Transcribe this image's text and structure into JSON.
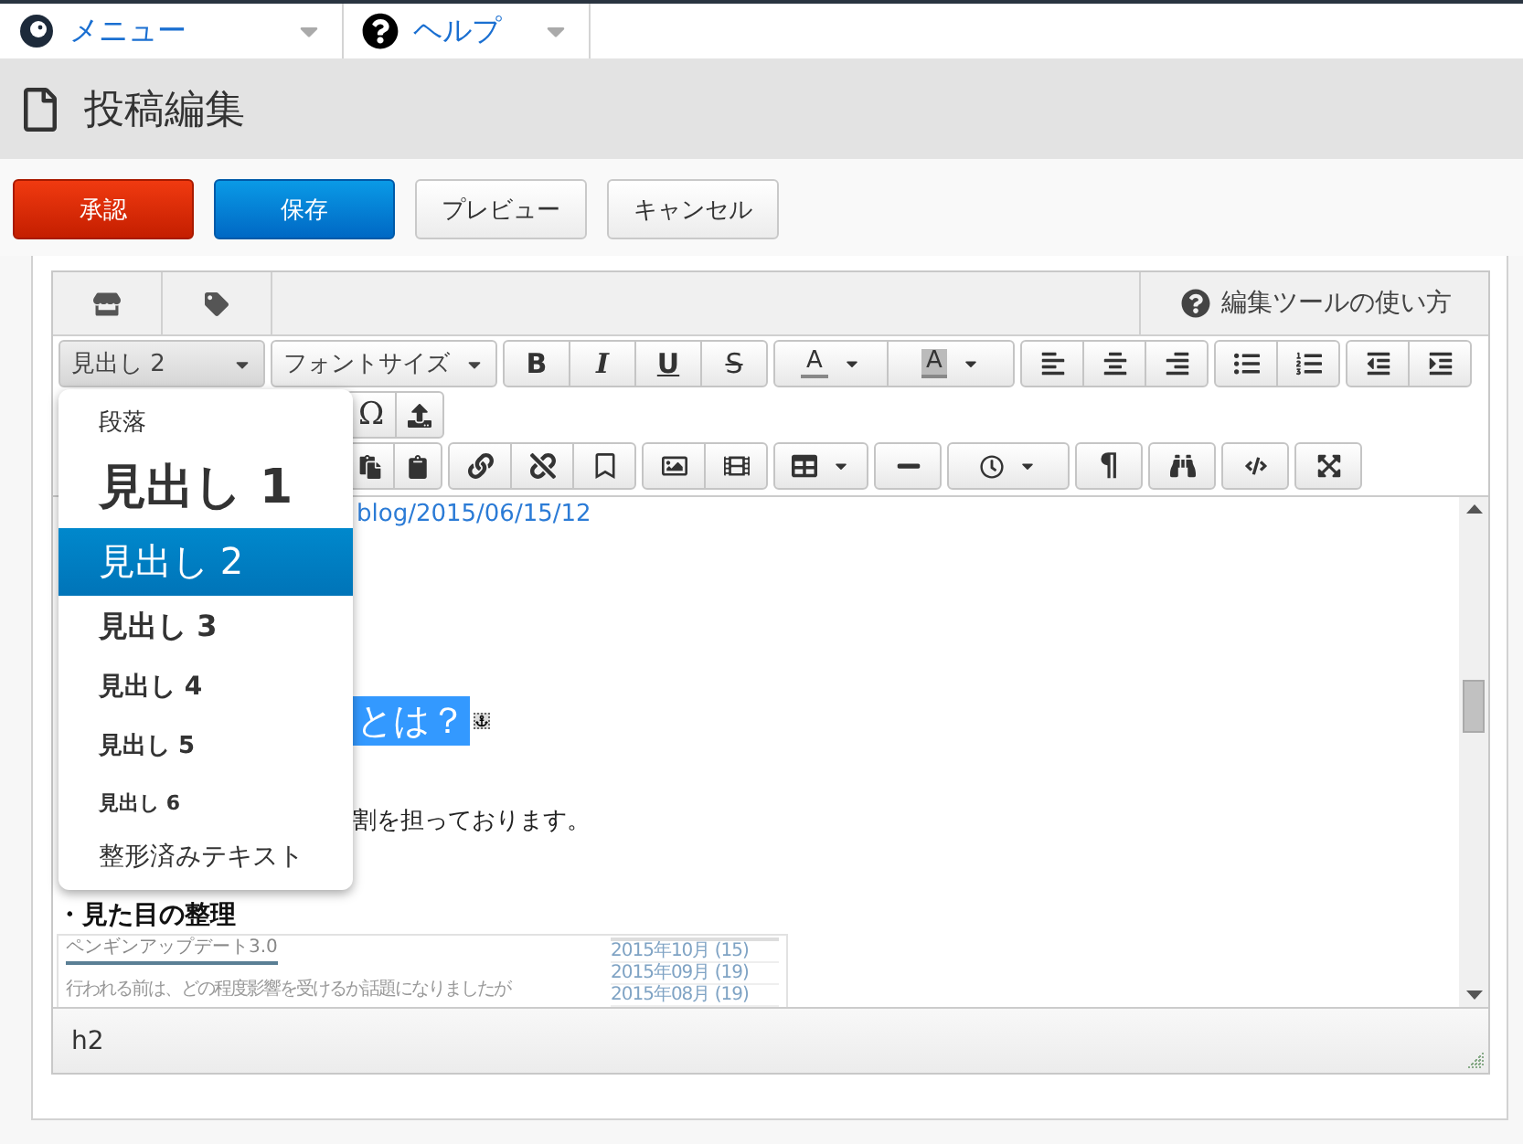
{
  "top_menu": [
    {
      "label": "メニュー",
      "kind": "logo"
    },
    {
      "label": "ヘルプ",
      "kind": "help"
    }
  ],
  "page_title": "投稿編集",
  "actions": [
    {
      "label": "承認",
      "kind": "approve"
    },
    {
      "label": "保存",
      "kind": "primary"
    },
    {
      "label": "プレビュー",
      "kind": "default"
    },
    {
      "label": "キャンセル",
      "kind": "default"
    }
  ],
  "editor": {
    "help_link": "編集ツールの使い方",
    "format_select": "見出し 2",
    "font_size_select": "フォントサイズ",
    "style_buttons": [
      "B",
      "I",
      "U",
      "S"
    ],
    "text_color": "A",
    "background_color": "A",
    "special_char": "Ω",
    "pilcrow": "¶",
    "content": {
      "link": "blog/2015/06/15/12",
      "selected_heading": "とは？",
      "paragraph": "割を担っております。",
      "bold_line": "・見た目の整理",
      "embedded_screenshot": {
        "title": "ペンギンアップデート3.0",
        "text": "行われる前は、どの程度影響を受けるか話題になりましたが",
        "archive": [
          "2015年10月 (15)",
          "2015年09月 (19)",
          "2015年08月 (19)"
        ]
      }
    },
    "status_path": "h2"
  },
  "format_menu": [
    {
      "label": "段落",
      "kind": "p",
      "selected": false
    },
    {
      "label": "見出し 1",
      "kind": "h1",
      "selected": false
    },
    {
      "label": "見出し 2",
      "kind": "h2",
      "selected": true
    },
    {
      "label": "見出し 3",
      "kind": "h3",
      "selected": false
    },
    {
      "label": "見出し 4",
      "kind": "h4",
      "selected": false
    },
    {
      "label": "見出し 5",
      "kind": "h5",
      "selected": false
    },
    {
      "label": "見出し 6",
      "kind": "h6",
      "selected": false
    },
    {
      "label": "整形済みテキスト",
      "kind": "pre",
      "selected": false
    }
  ]
}
